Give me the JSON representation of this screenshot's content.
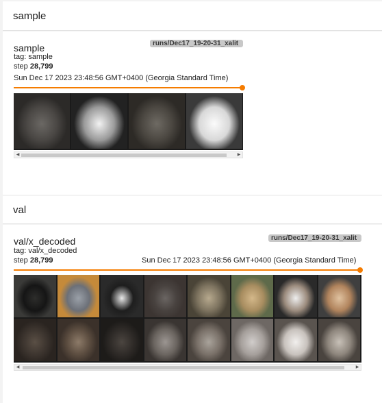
{
  "sections": [
    {
      "title": "sample",
      "card": {
        "title": "sample",
        "run": "runs/Dec17_19-20-31_xalit",
        "tag_line": "tag: sample",
        "step_label": "step",
        "step_value": "28,799",
        "timestamp": "Sun Dec 17 2023 23:48:56 GMT+0400 (Georgia Standard Time)",
        "slider_fraction": 1.0
      }
    },
    {
      "title": "val",
      "card": {
        "title": "val/x_decoded",
        "run": "runs/Dec17_19-20-31_xalit",
        "tag_line": "tag: val/x_decoded",
        "step_label": "step",
        "step_value": "28,799",
        "timestamp": "Sun Dec 17 2023 23:48:56 GMT+0400 (Georgia Standard Time)",
        "slider_fraction": 1.0
      }
    }
  ],
  "colors": {
    "accent": "#f57c00",
    "background": "#f3f3f3",
    "card": "#ffffff"
  }
}
